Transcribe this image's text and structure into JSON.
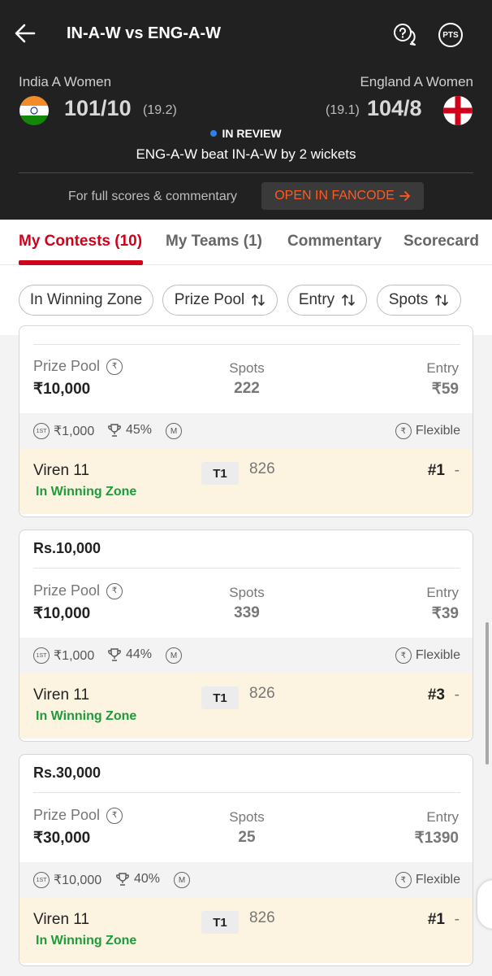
{
  "header": {
    "title": "IN-A-W vs ENG-A-W",
    "pts_label": "PTS",
    "team1": {
      "name": "India A Women",
      "score": "101/10",
      "overs": "(19.2)"
    },
    "team2": {
      "name": "England A Women",
      "score": "104/8",
      "overs": "(19.1)"
    },
    "status": "IN REVIEW",
    "result": "ENG-A-W beat IN-A-W by 2 wickets",
    "full_scores_text": "For full scores & commentary",
    "fancode_button": "OPEN IN FANCODE"
  },
  "tabs": [
    {
      "label": "My Contests (10)",
      "active": true
    },
    {
      "label": "My Teams (1)",
      "active": false
    },
    {
      "label": "Commentary",
      "active": false
    },
    {
      "label": "Scorecard",
      "active": false
    }
  ],
  "filters": [
    {
      "label": "In Winning Zone",
      "sortable": false
    },
    {
      "label": "Prize Pool",
      "sortable": true
    },
    {
      "label": "Entry",
      "sortable": true
    },
    {
      "label": "Spots",
      "sortable": true
    }
  ],
  "labels": {
    "prize_pool": "Prize Pool",
    "spots": "Spots",
    "entry": "Entry",
    "flexible": "Flexible",
    "first_badge": "1ST",
    "m_badge": "M"
  },
  "contests": [
    {
      "title": "",
      "prize": "₹10,000",
      "spots": "222",
      "entry": "₹59",
      "first_prize": "₹1,000",
      "win_pct": "45%",
      "team": {
        "name": "Viren 11",
        "zone": "In Winning Zone",
        "tag": "T1",
        "points": "826",
        "rank": "#1",
        "dash": "-"
      }
    },
    {
      "title": "Rs.10,000",
      "prize": "₹10,000",
      "spots": "339",
      "entry": "₹39",
      "first_prize": "₹1,000",
      "win_pct": "44%",
      "team": {
        "name": "Viren 11",
        "zone": "In Winning Zone",
        "tag": "T1",
        "points": "826",
        "rank": "#3",
        "dash": "-"
      }
    },
    {
      "title": "Rs.30,000",
      "prize": "₹30,000",
      "spots": "25",
      "entry": "₹1390",
      "first_prize": "₹10,000",
      "win_pct": "40%",
      "team": {
        "name": "Viren 11",
        "zone": "In Winning Zone",
        "tag": "T1",
        "points": "826",
        "rank": "#1",
        "dash": "-"
      }
    }
  ],
  "colors": {
    "accent": "#d0021b",
    "header_bg": "#212121",
    "winning_green": "#1e9b3b",
    "fancode": "#ff5a1f",
    "team_row_bg": "#fdf3e1"
  }
}
